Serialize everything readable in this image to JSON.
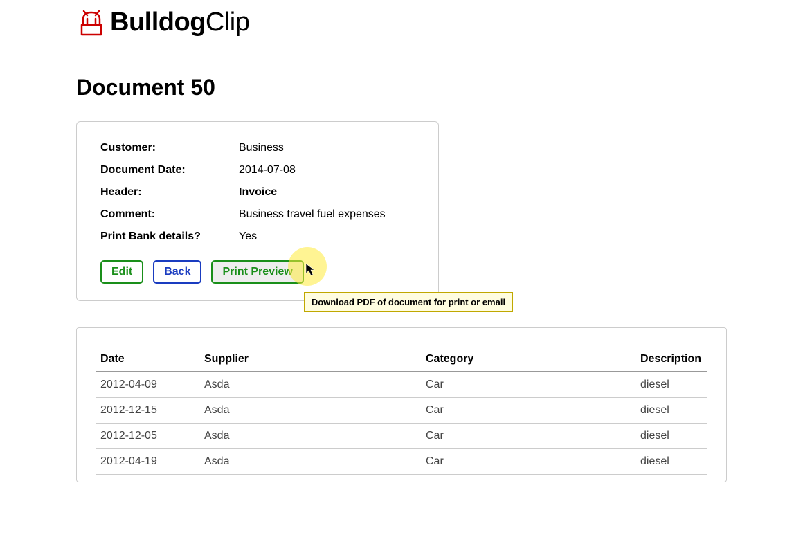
{
  "logo": {
    "bold": "Bulldog",
    "light": "Clip"
  },
  "page_title": "Document 50",
  "details": {
    "customer": {
      "label": "Customer:",
      "value": "Business"
    },
    "date": {
      "label": "Document Date:",
      "value": "2014-07-08"
    },
    "header": {
      "label": "Header:",
      "value": "Invoice"
    },
    "comment": {
      "label": "Comment:",
      "value": "Business travel fuel expenses"
    },
    "bank": {
      "label": "Print Bank details?",
      "value": "Yes"
    }
  },
  "buttons": {
    "edit": "Edit",
    "back": "Back",
    "preview": "Print Preview"
  },
  "tooltip": "Download PDF of document for print or email",
  "table": {
    "headers": {
      "date": "Date",
      "supplier": "Supplier",
      "category": "Category",
      "description": "Description"
    },
    "rows": [
      {
        "date": "2012-04-09",
        "supplier": "Asda",
        "category": "Car",
        "description": "diesel"
      },
      {
        "date": "2012-12-15",
        "supplier": "Asda",
        "category": "Car",
        "description": "diesel"
      },
      {
        "date": "2012-12-05",
        "supplier": "Asda",
        "category": "Car",
        "description": "diesel"
      },
      {
        "date": "2012-04-19",
        "supplier": "Asda",
        "category": "Car",
        "description": "diesel"
      }
    ]
  }
}
